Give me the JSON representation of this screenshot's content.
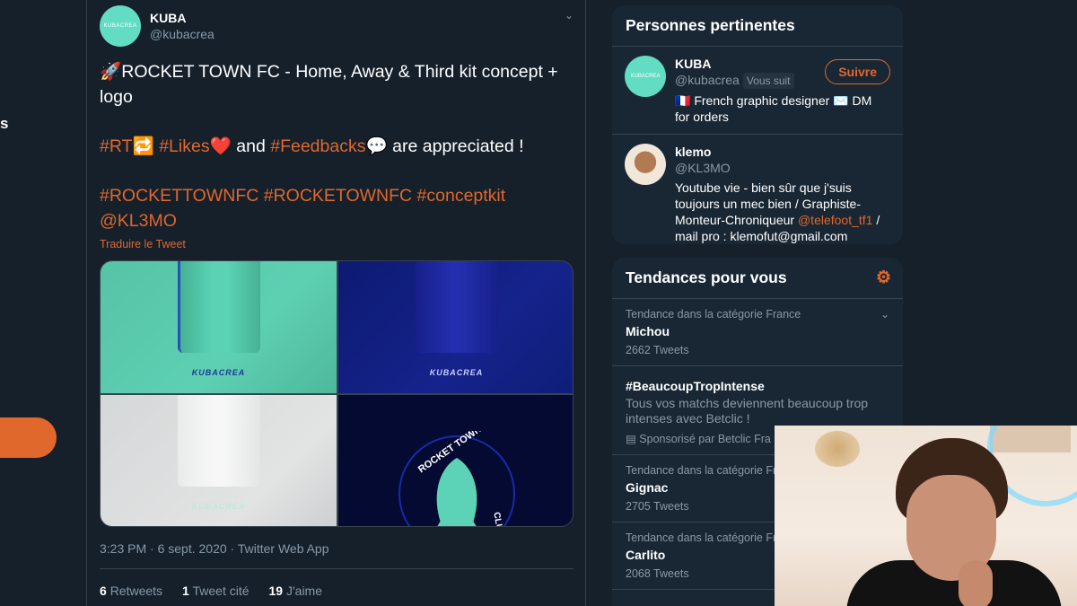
{
  "nav": {
    "fragment": "s"
  },
  "tweet": {
    "name": "KUBA",
    "handle": "@kubacrea",
    "avatar_text": "KUBACREA",
    "title_emoji": "🚀",
    "title": "ROCKET TOWN FC - Home, Away & Third kit concept + logo",
    "line2": {
      "rt": "#RT",
      "rt_emoji": "🔁",
      "likes": "#Likes",
      "likes_emoji": "❤️",
      "and": " and ",
      "feedbacks": "#Feedbacks",
      "feedbacks_emoji": "💬",
      "rest": " are appreciated !"
    },
    "hashtags": "#ROCKETTOWNFC #ROCKETOWNFC #conceptkit",
    "mention": "@KL3MO",
    "translate": "Traduire le Tweet",
    "media": {
      "brand": "KUBACREA",
      "crest_top": "ROCKET TOWN",
      "crest_side": "CLUB"
    },
    "meta": "3:23 PM · 6 sept. 2020 · Twitter Web App",
    "stats": [
      {
        "count": "6",
        "label": "Retweets"
      },
      {
        "count": "1",
        "label": "Tweet cité"
      },
      {
        "count": "19",
        "label": "J'aime"
      }
    ]
  },
  "people": {
    "title": "Personnes pertinentes",
    "follow_label": "Suivre",
    "items": [
      {
        "name": "KUBA",
        "handle": "@kubacrea",
        "badge": "Vous suit",
        "avatar_text": "KUBACREA",
        "bio": "🇫🇷 French graphic designer ✉️ DM for orders"
      },
      {
        "name": "klemo",
        "handle": "@KL3MO",
        "bio_pre": "Youtube vie - bien sûr que j'suis toujours un mec bien / Graphiste-Monteur-Chroniqueur ",
        "bio_mention": "@telefoot_tf1",
        "bio_post": " / mail pro : klemofut@gmail.com"
      }
    ]
  },
  "trends": {
    "title": "Tendances pour vous",
    "items": [
      {
        "category": "Tendance dans la catégorie France",
        "name": "Michou",
        "count": "2662 Tweets"
      },
      {
        "category": "",
        "name": "#BeaucoupTropIntense",
        "desc": "Tous vos matchs deviennent beaucoup trop intenses avec Betclic !",
        "sponsor": "Sponsorisé par Betclic Fra"
      },
      {
        "category": "Tendance dans la catégorie Fr",
        "name": "Gignac",
        "count": "2705 Tweets"
      },
      {
        "category": "Tendance dans la catégorie Fr",
        "name": "Carlito",
        "count": "2068 Tweets"
      }
    ]
  },
  "colors": {
    "accent": "#e0682c",
    "background": "#15202b",
    "card": "#192734",
    "muted": "#8899a6"
  }
}
